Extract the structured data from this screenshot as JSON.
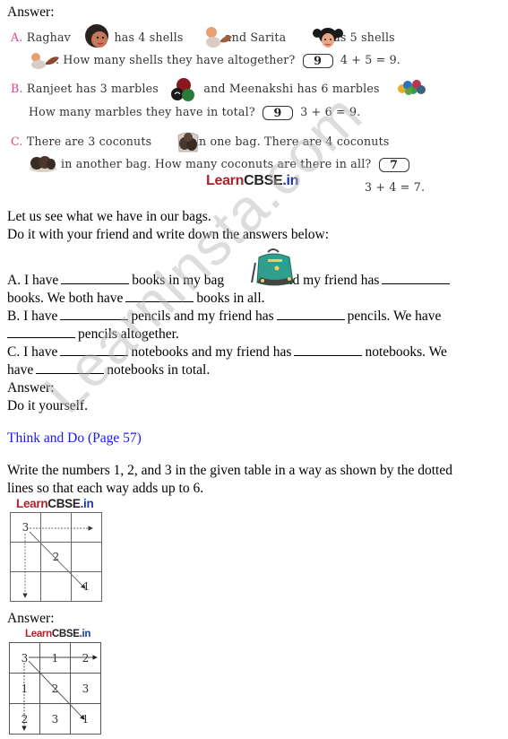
{
  "section1": {
    "answer_label": "Answer:",
    "questions": [
      {
        "label": "A.",
        "line1": [
          "Raghav",
          "has 4 shells",
          "and Sarita",
          "has 5 shells"
        ],
        "line2_text": ". How many shells they have altogether?",
        "answer": "9",
        "equation": "4 + 5 = 9."
      },
      {
        "label": "B.",
        "line1": [
          "Ranjeet has 3 marbles",
          "and Meenakshi has 6 marbles",
          "."
        ],
        "line2_text": "How many marbles they have in total?",
        "answer": "9",
        "equation": "3 + 6 = 9."
      },
      {
        "label": "C.",
        "line1": [
          "There are 3 coconuts",
          "in one bag. There are 4 coconuts"
        ],
        "line2_text": "in another bag. How many coconuts are there in all?",
        "answer": "7",
        "equation": "3 + 4 = 7."
      }
    ],
    "brand": {
      "learn": "Learn",
      "cbse": "CBSE",
      "in": ".in"
    }
  },
  "section2": {
    "intro_line1": "Let us see what we have in our bags.",
    "intro_line2": "Do it with your friend and write down the answers below:",
    "a_part1": "A. I have",
    "a_part2": "books in my bag",
    "a_part3": "and my friend has",
    "a2_part1": "books. We both have",
    "a2_part2": "books in all.",
    "b_part1": "B. I have",
    "b_part2": "pencils and my friend has",
    "b_part3": "pencils. We have",
    "b2_part1": "pencils altogether.",
    "c_part1": "C. I have",
    "c_part2": "notebooks and my friend has",
    "c_part3": "notebooks. We",
    "c2_part1": "have",
    "c2_part2": "notebooks in total.",
    "answer_label": "Answer:",
    "answer_text": "Do it yourself."
  },
  "section3": {
    "heading": "Think and Do (Page 57)",
    "instruction_line1": "Write the numbers 1, 2, and 3 in the given table in a way as shown by the dotted",
    "instruction_line2": "lines so that each way adds up to 6.",
    "question_grid": [
      [
        "3",
        "",
        ""
      ],
      [
        "",
        "2",
        ""
      ],
      [
        "",
        "",
        "1"
      ]
    ],
    "answer_label": "Answer:",
    "answer_grid": [
      [
        "3",
        "1",
        "2"
      ],
      [
        "1",
        "2",
        "3"
      ],
      [
        "2",
        "3",
        "1"
      ]
    ]
  },
  "watermark": "LearnInsta.com",
  "colors": {
    "question_label": "#e0408a",
    "heading_blue": "#1a1aee",
    "brand_red": "#b0202a",
    "brand_blue": "#1e36a8"
  }
}
